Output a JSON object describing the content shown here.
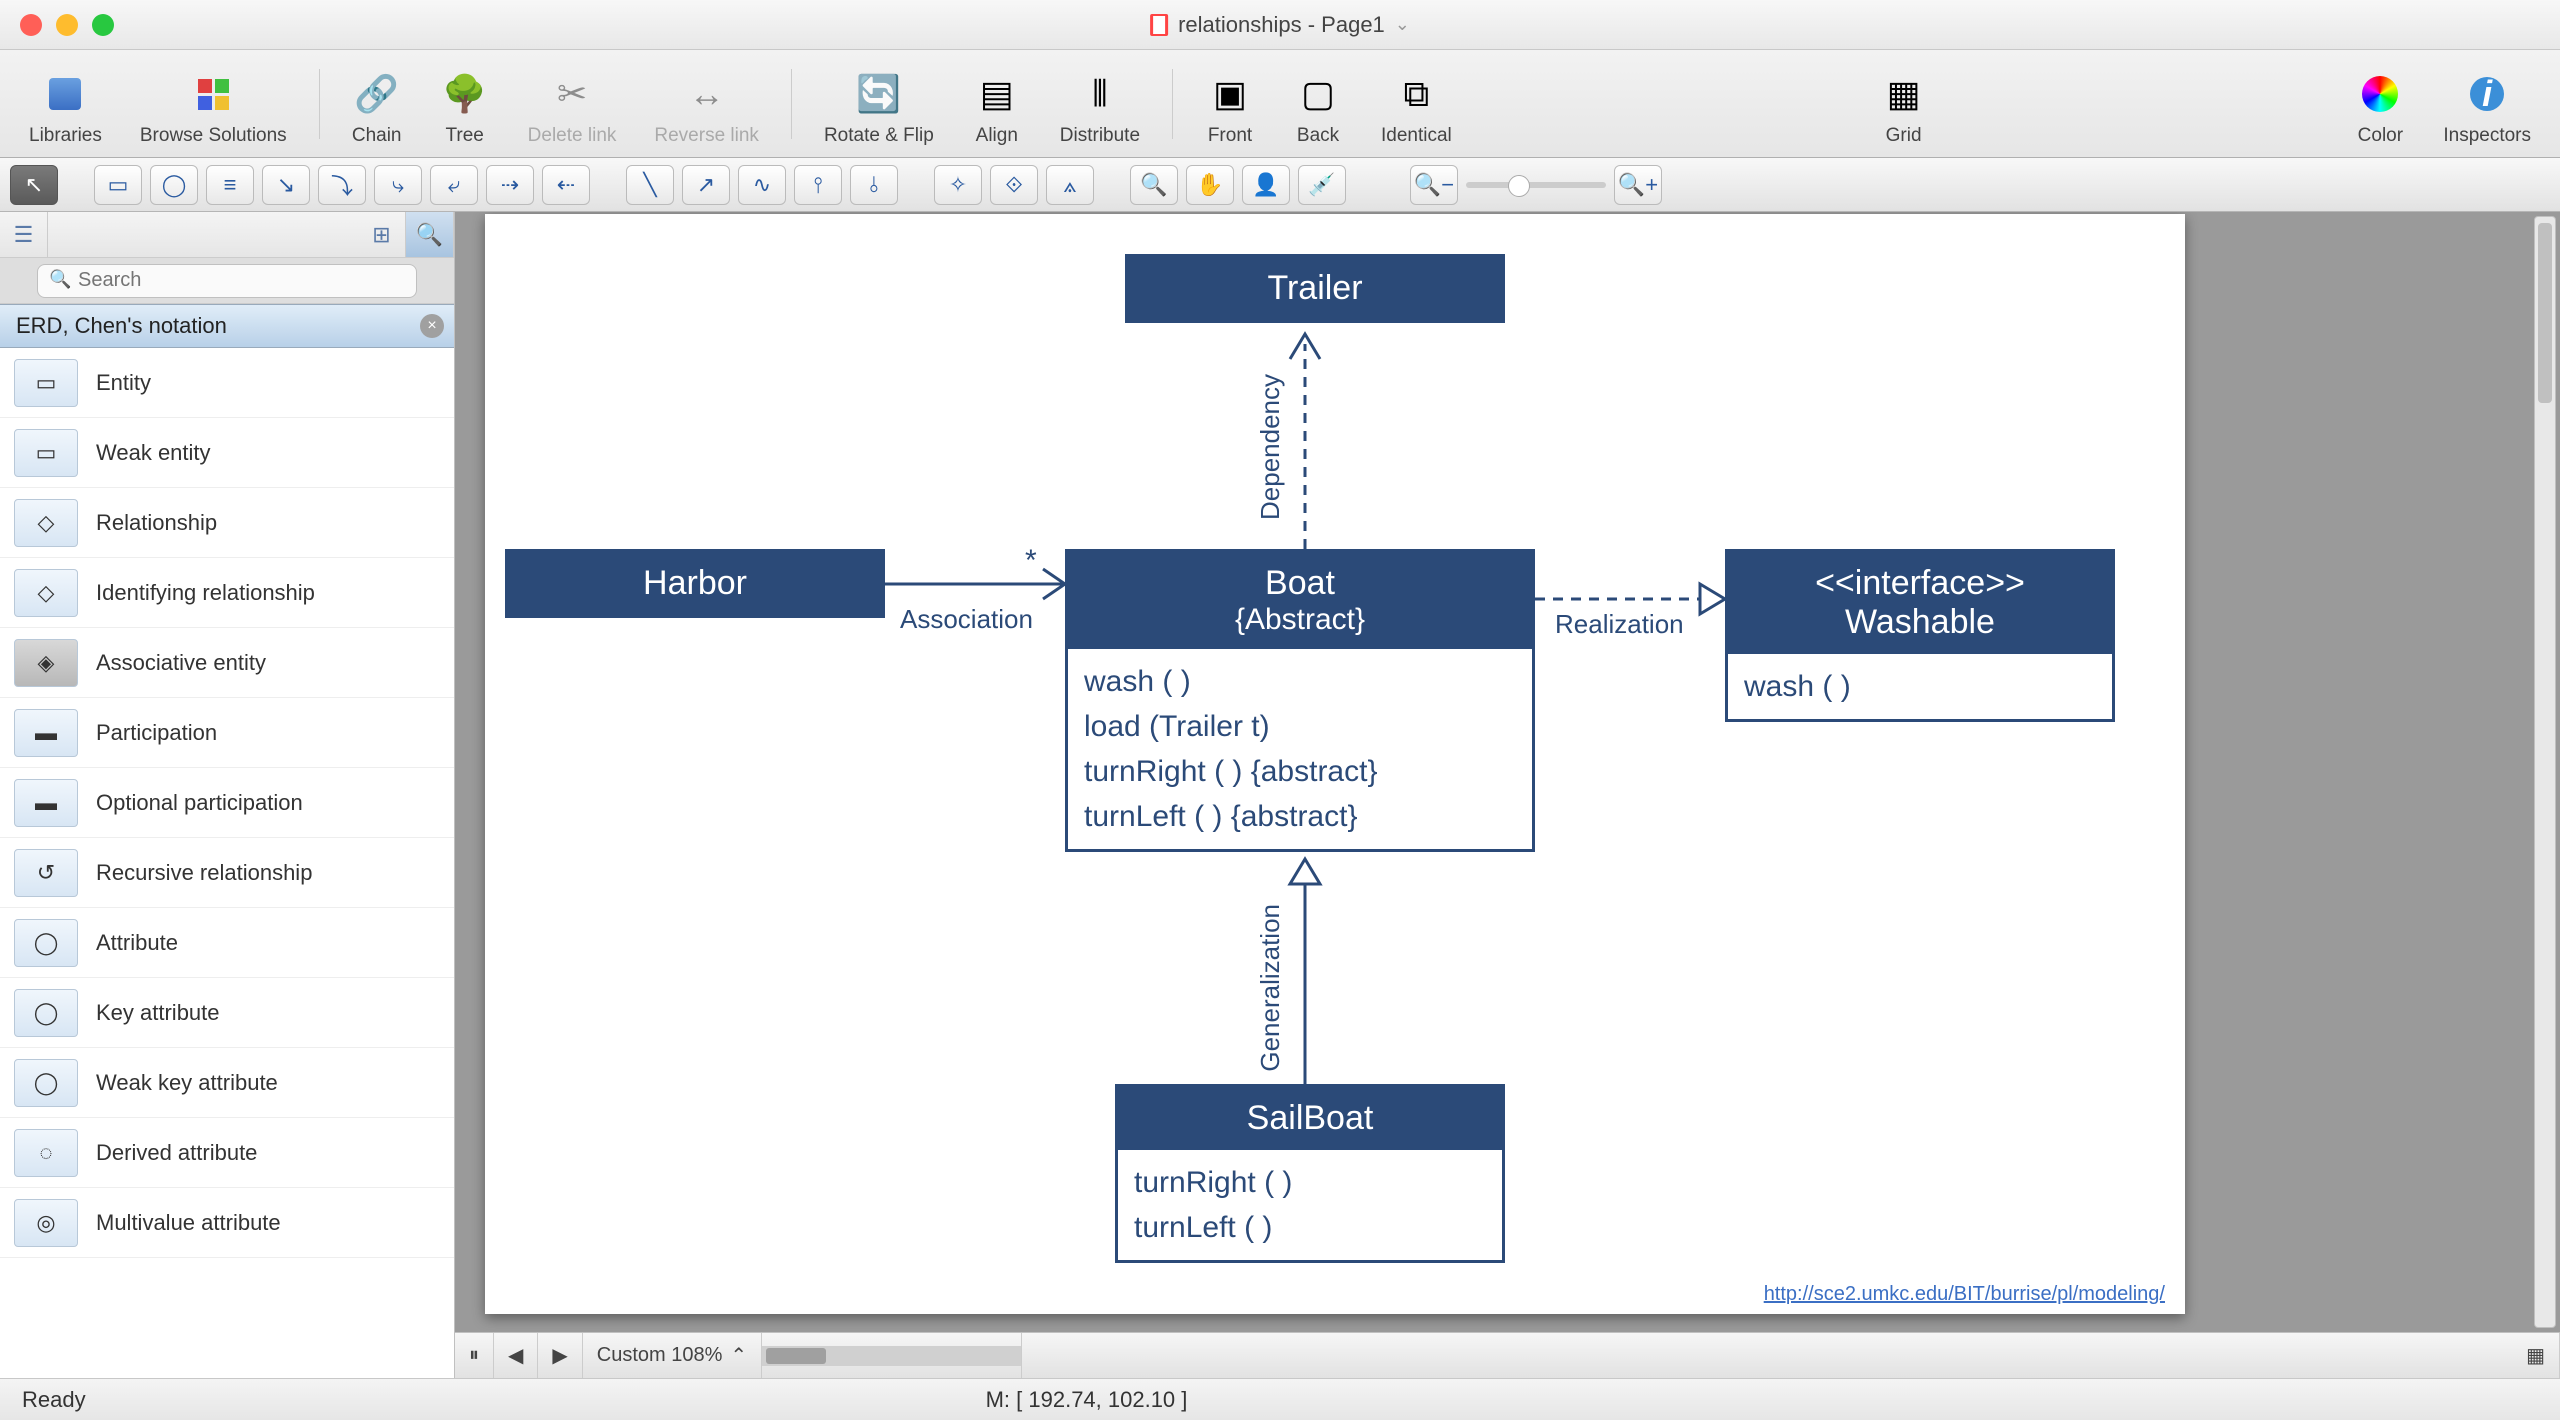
{
  "window": {
    "title": "relationships - Page1"
  },
  "toolbar": {
    "libraries": "Libraries",
    "browse": "Browse Solutions",
    "chain": "Chain",
    "tree": "Tree",
    "delete_link": "Delete link",
    "reverse_link": "Reverse link",
    "rotate_flip": "Rotate & Flip",
    "align": "Align",
    "distribute": "Distribute",
    "front": "Front",
    "back": "Back",
    "identical": "Identical",
    "grid": "Grid",
    "color": "Color",
    "inspectors": "Inspectors"
  },
  "search": {
    "placeholder": "Search"
  },
  "library_group": "ERD, Chen's notation",
  "library_items": [
    "Entity",
    "Weak entity",
    "Relationship",
    "Identifying relationship",
    "Associative entity",
    "Participation",
    "Optional participation",
    "Recursive relationship",
    "Attribute",
    "Key attribute",
    "Weak key attribute",
    "Derived attribute",
    "Multivalue attribute"
  ],
  "diagram": {
    "trailer": "Trailer",
    "harbor": "Harbor",
    "boat_title": "Boat",
    "boat_sub": "{Abstract}",
    "boat_ops": [
      "wash ( )",
      "load (Trailer t)",
      "turnRight ( ) {abstract}",
      "turnLeft ( ) {abstract}"
    ],
    "interface_stereo": "<<interface>>",
    "interface_name": "Washable",
    "interface_ops": [
      "wash ( )"
    ],
    "sailboat": "SailBoat",
    "sailboat_ops": [
      "turnRight ( )",
      "turnLeft ( )"
    ],
    "lbl_dependency": "Dependency",
    "lbl_association": "Association",
    "lbl_assoc_mult": "*",
    "lbl_realization": "Realization",
    "lbl_generalization": "Generalization",
    "link": "http://sce2.umkc.edu/BIT/burrise/pl/modeling/"
  },
  "bottom": {
    "zoom": "Custom 108%"
  },
  "status": {
    "ready": "Ready",
    "coords": "M: [ 192.74, 102.10 ]"
  }
}
